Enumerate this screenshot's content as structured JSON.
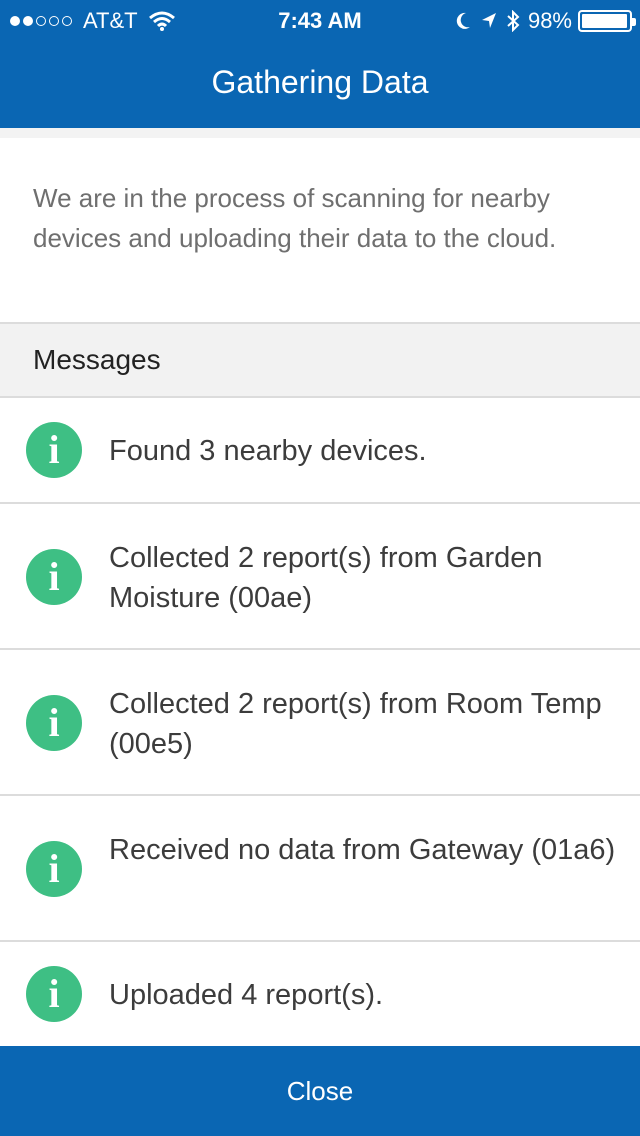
{
  "status_bar": {
    "carrier": "AT&T",
    "time": "7:43 AM",
    "battery": "98%",
    "signal_dots_filled": 2,
    "signal_dots_total": 5,
    "battery_level": 0.98
  },
  "nav": {
    "title": "Gathering Data"
  },
  "intro": {
    "text": "We are in the process of scanning for nearby devices and uploading their data to the cloud."
  },
  "messages_section": {
    "title": "Messages"
  },
  "messages": [
    {
      "icon": "info-icon",
      "text": "Found 3 nearby devices."
    },
    {
      "icon": "info-icon",
      "text": "Collected 2 report(s) from Garden Moisture (00ae)"
    },
    {
      "icon": "info-icon",
      "text": "Collected 2 report(s) from Room Temp (00e5)"
    },
    {
      "icon": "info-icon",
      "text": "Received no data from Gateway (01a6)"
    },
    {
      "icon": "info-icon",
      "text": "Uploaded 4 report(s)."
    }
  ],
  "footer": {
    "close_label": "Close"
  },
  "colors": {
    "primary": "#0a66b3",
    "info_green": "#3ebf84"
  }
}
